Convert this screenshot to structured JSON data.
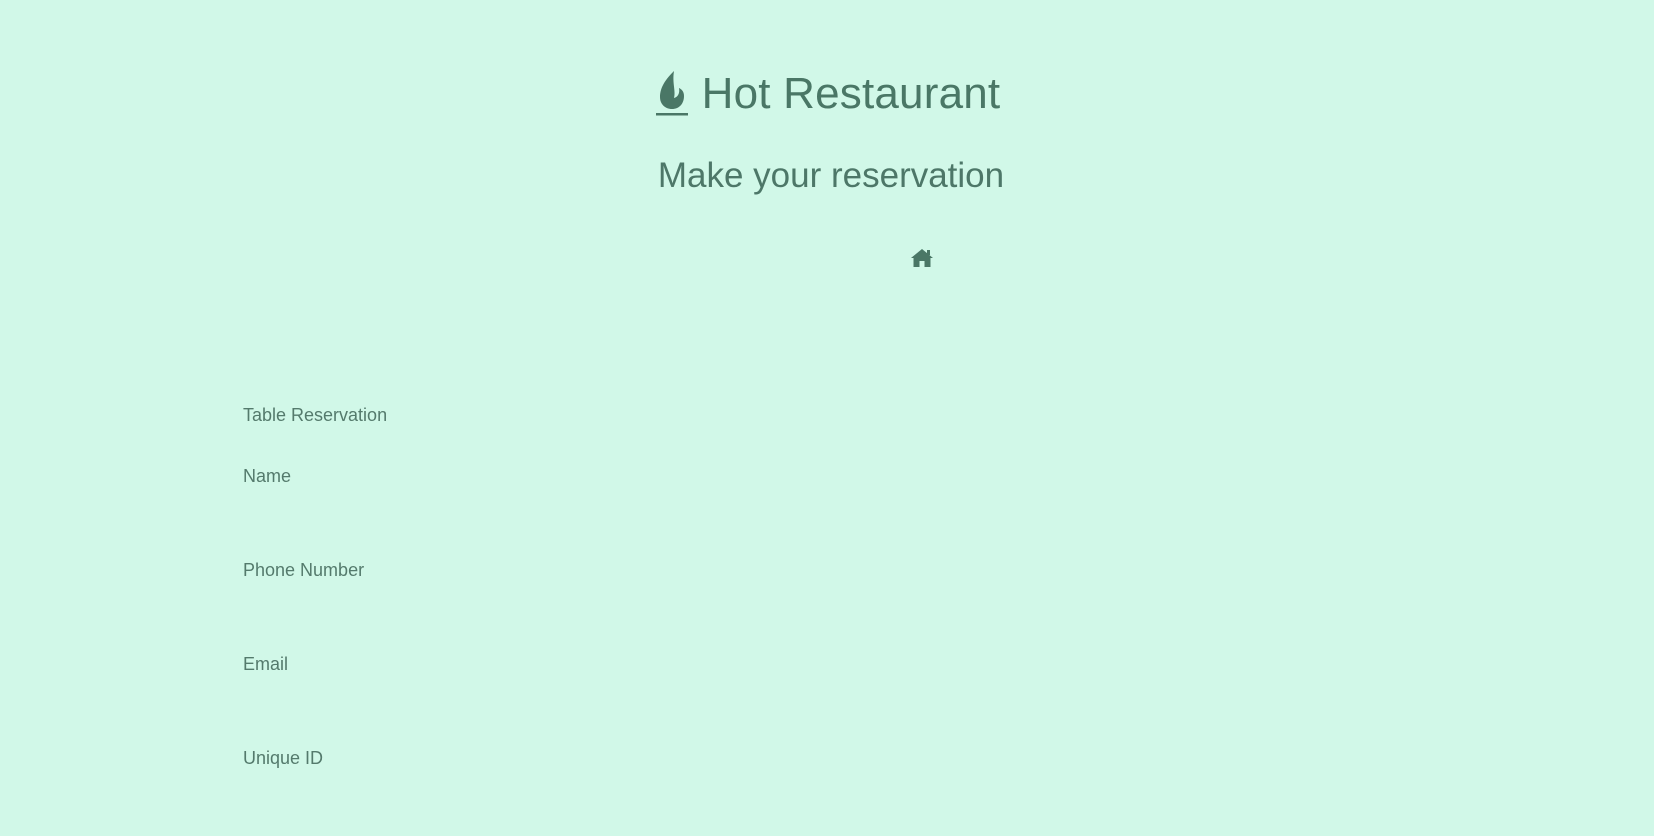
{
  "app": {
    "title": "Hot Restaurant",
    "subtitle": "Make your reservation",
    "brand_icon": "flame-icon",
    "home_icon": "home-icon",
    "colors": {
      "background": "#d1f8e8",
      "text": "#4d7768",
      "accent": "#4a7766"
    }
  },
  "form": {
    "heading": "Table Reservation",
    "fields": [
      {
        "label": "Name",
        "value": ""
      },
      {
        "label": "Phone Number",
        "value": ""
      },
      {
        "label": "Email",
        "value": ""
      },
      {
        "label": "Unique ID",
        "value": ""
      }
    ]
  }
}
